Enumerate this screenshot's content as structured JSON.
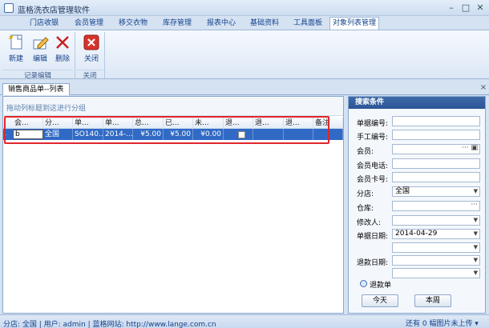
{
  "window": {
    "title": "蓝格洗衣店管理软件",
    "minimize": "–",
    "maximize": "□",
    "close": "✕"
  },
  "tabs": [
    {
      "label": "门店收银"
    },
    {
      "label": "会员管理"
    },
    {
      "label": "移交衣物"
    },
    {
      "label": "库存管理"
    },
    {
      "label": "报表中心"
    },
    {
      "label": "基础资料"
    },
    {
      "label": "工具面板"
    },
    {
      "label": "对象列表管理"
    }
  ],
  "active_tab_index": 7,
  "ribbon": {
    "buttons": [
      {
        "label": "新建",
        "icon": "new-document-icon"
      },
      {
        "label": "编辑",
        "icon": "edit-pencil-icon"
      },
      {
        "label": "删除",
        "icon": "delete-x-icon"
      },
      {
        "label": "关闭",
        "icon": "close-red-icon"
      }
    ],
    "groups": [
      {
        "label": "记录编辑"
      },
      {
        "label": "关闭"
      }
    ]
  },
  "document_tab": {
    "label": "销售商品单--列表",
    "close": "×"
  },
  "grid": {
    "group_hint": "拖动列标题到这进行分组",
    "columns": [
      "会...",
      "分...",
      "单...",
      "单...",
      "总...",
      "已...",
      "未...",
      "退...",
      "退...",
      "退...",
      "备注"
    ],
    "rows": [
      {
        "cells": [
          "b",
          "全国",
          "SO140...",
          "2014-...",
          "¥5.00",
          "¥5.00",
          "¥0.00",
          "",
          "",
          "",
          ""
        ],
        "refund_checked": false
      }
    ],
    "row_indicator": "›"
  },
  "search": {
    "title": "搜索条件",
    "fields": [
      {
        "label": "单据编号:",
        "value": "",
        "kind": "text"
      },
      {
        "label": "手工编号:",
        "value": "",
        "kind": "text"
      },
      {
        "label": "会员:",
        "value": "",
        "kind": "lookup"
      },
      {
        "label": "会员电话:",
        "value": "",
        "kind": "text"
      },
      {
        "label": "会员卡号:",
        "value": "",
        "kind": "text"
      },
      {
        "label": "分店:",
        "value": "全国",
        "kind": "select"
      },
      {
        "label": "仓库:",
        "value": "",
        "kind": "lookup"
      },
      {
        "label": "修改人:",
        "value": "",
        "kind": "select"
      },
      {
        "label": "单据日期:",
        "value": "2014-04-29",
        "kind": "select"
      },
      {
        "label": "",
        "value": "",
        "kind": "select"
      },
      {
        "label": "退款日期:",
        "value": "",
        "kind": "select"
      },
      {
        "label": "",
        "value": "",
        "kind": "select"
      }
    ],
    "refund_toggle": "退款单",
    "today_button": "今天",
    "week_button": "本周"
  },
  "status": {
    "text": "分店: 全国 | 用户: admin | 蓝格网站: http://www.lange.com.cn",
    "right_text": "还有 0 幅图片未上传 ▾"
  },
  "colors": {
    "selection": "#316ac5",
    "highlight_border": "#e0262b",
    "search_header": "#2a5597"
  }
}
